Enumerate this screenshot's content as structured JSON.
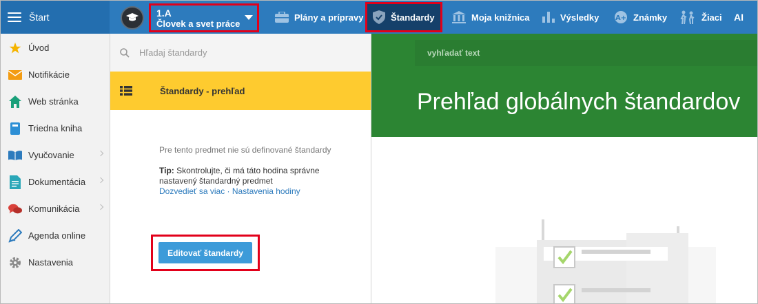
{
  "topbar": {
    "brand_label": "Štart",
    "class_name": "1.A",
    "class_subject": "Človek a svet práce",
    "nav": [
      {
        "label": "Plány a prípravy",
        "icon": "briefcase-icon"
      },
      {
        "label": "Štandardy",
        "icon": "shield-check-icon",
        "active": true
      },
      {
        "label": "Moja knižnica",
        "icon": "library-icon"
      },
      {
        "label": "Výsledky",
        "icon": "bar-chart-icon"
      },
      {
        "label": "Známky",
        "icon": "grade-icon"
      },
      {
        "label": "Žiaci",
        "icon": "students-icon"
      },
      {
        "label": "AI",
        "icon": ""
      }
    ]
  },
  "sidebar": {
    "items": [
      {
        "label": "Úvod",
        "icon": "star-icon"
      },
      {
        "label": "Notifikácie",
        "icon": "envelope-icon"
      },
      {
        "label": "Web stránka",
        "icon": "home-icon"
      },
      {
        "label": "Triedna kniha",
        "icon": "book-icon"
      },
      {
        "label": "Vyučovanie",
        "icon": "open-book-icon",
        "submenu": true
      },
      {
        "label": "Dokumentácia",
        "icon": "document-icon",
        "submenu": true
      },
      {
        "label": "Komunikácia",
        "icon": "chat-icon",
        "submenu": true
      },
      {
        "label": "Agenda online",
        "icon": "pen-icon"
      },
      {
        "label": "Nastavenia",
        "icon": "gear-icon"
      }
    ]
  },
  "middle": {
    "search_placeholder": "Hľadaj štandardy",
    "overview_label": "Štandardy - prehľad",
    "empty_message": "Pre tento predmet nie sú definované štandardy",
    "tip_label": "Tip:",
    "tip_text": " Skontrolujte, či má táto hodina správne nastavený štandardný predmet",
    "link_more": "Dozvedieť sa viac",
    "link_separator": " · ",
    "link_settings": "Nastavenia hodiny",
    "edit_button": "Editovať štandardy"
  },
  "right": {
    "search_placeholder": "vyhľadať text",
    "title": "Prehľad globálnych štandardov"
  },
  "colors": {
    "topbar": "#2d7bbd",
    "highlight": "#e2001a",
    "overview_row": "#fecb2f",
    "hero": "#2c8533",
    "button": "#3d9bd9"
  }
}
